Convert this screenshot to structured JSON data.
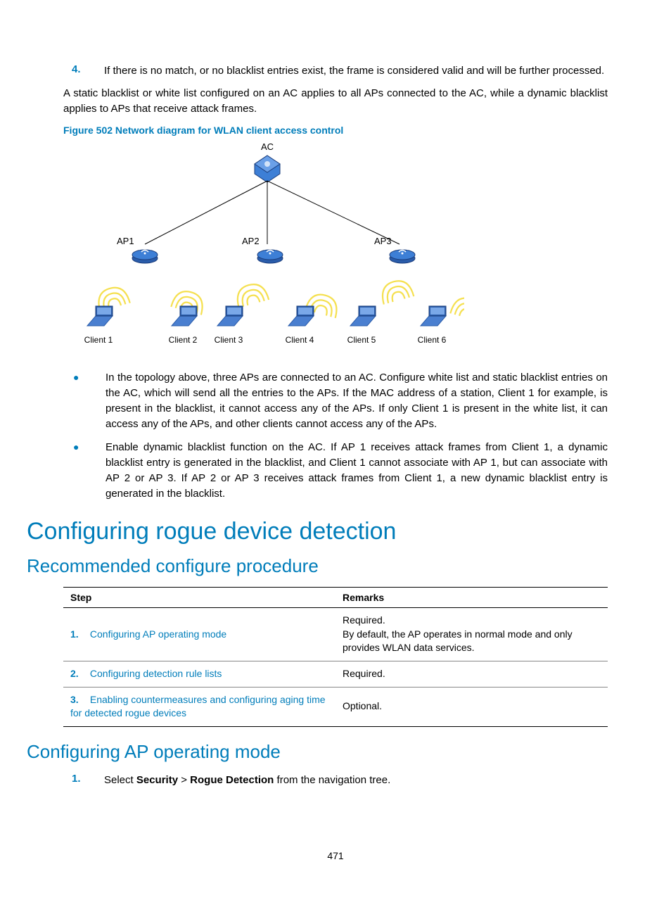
{
  "list4": {
    "num": "4.",
    "text": "If there is no match, or no blacklist entries exist, the frame is considered valid and will be further processed."
  },
  "para_static": "A static blacklist or white list configured on an AC applies to all APs connected to the AC, while a dynamic blacklist applies to APs that receive attack frames.",
  "figure_caption": "Figure 502 Network diagram for WLAN client access control",
  "diagram": {
    "ac": "AC",
    "aps": [
      "AP1",
      "AP2",
      "AP3"
    ],
    "clients": [
      "Client 1",
      "Client 2",
      "Client 3",
      "Client 4",
      "Client 5",
      "Client 6"
    ]
  },
  "bullets": [
    "In the topology above, three APs are connected to an AC. Configure white list and static blacklist entries on the AC, which will send all the entries to the APs. If the MAC address of a station, Client 1 for example, is present in the blacklist, it cannot access any of the APs. If only Client 1 is present in the white list, it can access any of the APs, and other clients cannot access any of the APs.",
    "Enable dynamic blacklist function on the AC. If AP 1 receives attack frames from Client 1, a dynamic blacklist entry is generated in the blacklist, and Client 1 cannot associate with AP 1, but can associate with AP 2 or AP 3. If AP 2 or AP 3 receives attack frames from Client 1, a new dynamic blacklist entry is generated in the blacklist."
  ],
  "h1": "Configuring rogue device detection",
  "h2a": "Recommended configure procedure",
  "table": {
    "headers": [
      "Step",
      "Remarks"
    ],
    "rows": [
      {
        "num": "1.",
        "step": "Configuring AP operating mode",
        "remarks": "Required.\nBy default, the AP operates in normal mode and only provides WLAN data services."
      },
      {
        "num": "2.",
        "step": "Configuring detection rule lists",
        "remarks": "Required."
      },
      {
        "num": "3.",
        "step": "Enabling countermeasures and configuring aging time for detected rogue devices",
        "remarks": "Optional."
      }
    ]
  },
  "h2b": "Configuring AP operating mode",
  "step1": {
    "num": "1.",
    "pre": "Select ",
    "b1": "Security",
    "mid": " > ",
    "b2": "Rogue Detection",
    "post": " from the navigation tree."
  },
  "page_number": "471"
}
